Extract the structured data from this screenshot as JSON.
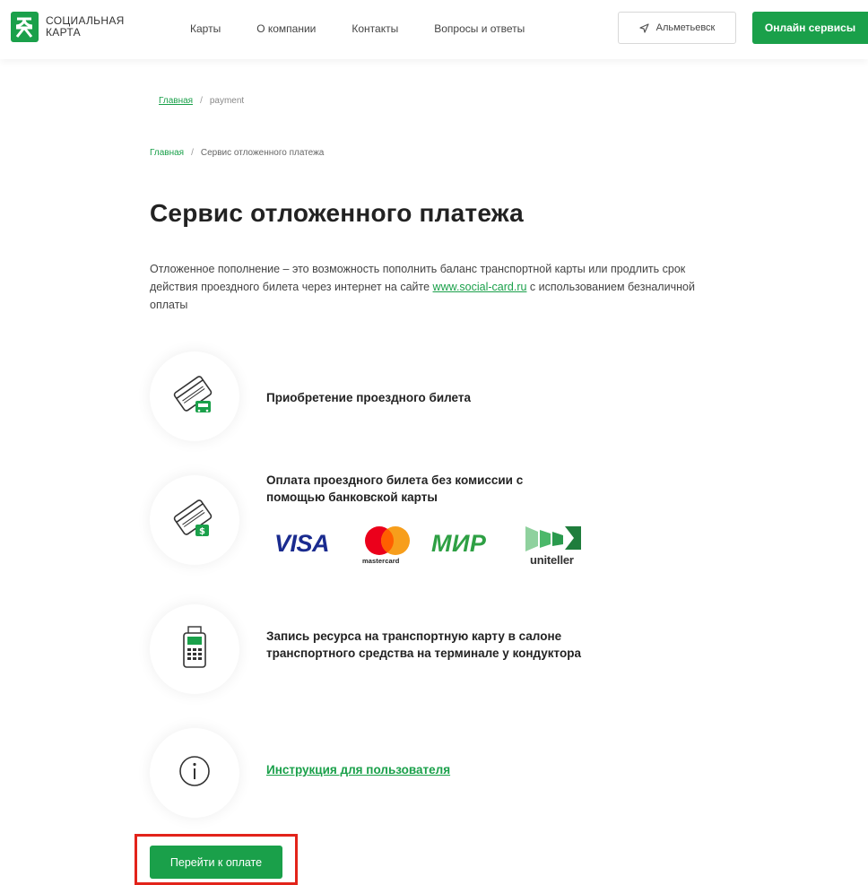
{
  "header": {
    "logo_line1": "СОЦИАЛЬНАЯ",
    "logo_line2": "КАРТА",
    "nav": [
      "Карты",
      "О компании",
      "Контакты",
      "Вопросы и ответы"
    ],
    "city": "Альметьевск",
    "online_services": "Онлайн сервисы"
  },
  "breadcrumb_top": {
    "home": "Главная",
    "separator": "/",
    "current": "payment"
  },
  "breadcrumb": {
    "home": "Главная",
    "separator": "/",
    "current": "Сервис отложенного платежа"
  },
  "page_title": "Сервис отложенного платежа",
  "intro": {
    "text_before": "Отложенное пополнение – это возможность пополнить баланс транспортной карты или продлить срок действия проездного билета через интернет на сайте ",
    "link": "www.social-card.ru",
    "text_after": " с использованием безналичной оплаты"
  },
  "steps": [
    {
      "icon": "card-bus-icon",
      "text": "Приобретение проездного билета"
    },
    {
      "icon": "card-dollar-icon",
      "text_line1": "Оплата проездного билета без комиссии с",
      "text_line2": "помощью банковской карты"
    },
    {
      "icon": "terminal-icon",
      "text_line1": "Запись ресурса на транспортную карту в салоне",
      "text_line2": "транспортного средства на терминале у кондуктора"
    },
    {
      "icon": "info-icon",
      "link": "Инструкция для пользователя"
    }
  ],
  "payment_logos": {
    "visa": "VISA",
    "mastercard": "mastercard",
    "mir": "МИР",
    "uniteller": "uniteller"
  },
  "pay_button": "Перейти к оплате",
  "colors": {
    "brand_green": "#1aa04a",
    "highlight_red": "#e2231a"
  }
}
